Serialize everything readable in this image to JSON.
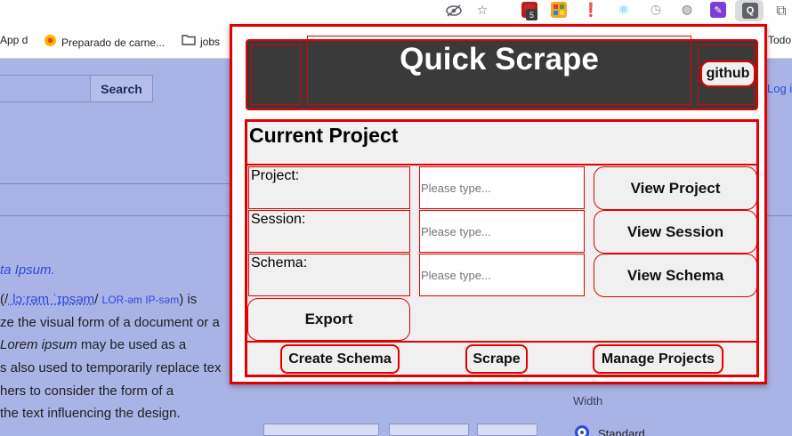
{
  "browser": {
    "bookmarks": [
      {
        "label": "App d",
        "icon": ""
      },
      {
        "label": "Preparado de carne...",
        "icon": "food-icon"
      },
      {
        "label": "jobs",
        "icon": "folder-icon"
      },
      {
        "label": "Todo",
        "icon": ""
      }
    ],
    "extension_icons": [
      {
        "name": "eye-off-icon"
      },
      {
        "name": "star-icon"
      },
      {
        "name": "shield-extension-icon",
        "badge": "5"
      },
      {
        "name": "rss-extension-icon"
      },
      {
        "name": "red-flag-extension-icon"
      },
      {
        "name": "react-devtools-icon"
      },
      {
        "name": "clock-extension-icon"
      },
      {
        "name": "globe-extension-icon"
      },
      {
        "name": "purple-extension-icon"
      },
      {
        "name": "quick-scrape-extension-icon",
        "label": "Q"
      },
      {
        "name": "puzzle-icon"
      }
    ]
  },
  "background_page": {
    "search_button": "Search",
    "login_link": "Log in",
    "lines": {
      "l1": "ta Ipsum.",
      "l2_pre": "(/",
      "l2_pron": "ˌlɔːrəm ˈɪpsəm",
      "l2_mid": "/ ",
      "l2_resp": "LOR-əm IP-səm",
      "l2_post": ") is",
      "l3": "ze the visual form of a document or a",
      "l4_em": "Lorem ipsum",
      "l4_rest": " may be used as a",
      "l5": "s also used to temporarily replace tex",
      "l6": "hers to consider the form of a",
      "l7": "the text influencing the design."
    },
    "width_label": "Width",
    "standard_label": "Standard"
  },
  "popup": {
    "title": "Quick Scrape",
    "github_label": "github",
    "section_title": "Current Project",
    "rows": [
      {
        "label": "Project:",
        "placeholder": "Please type...",
        "button": "View Project"
      },
      {
        "label": "Session:",
        "placeholder": "Please type...",
        "button": "View Session"
      },
      {
        "label": "Schema:",
        "placeholder": "Please type...",
        "button": "View Schema"
      }
    ],
    "export_label": "Export",
    "footer": {
      "create_schema": "Create Schema",
      "scrape": "Scrape",
      "manage_projects": "Manage Projects"
    },
    "accent_color": "#e30000",
    "header_color": "#3a3a3a"
  }
}
